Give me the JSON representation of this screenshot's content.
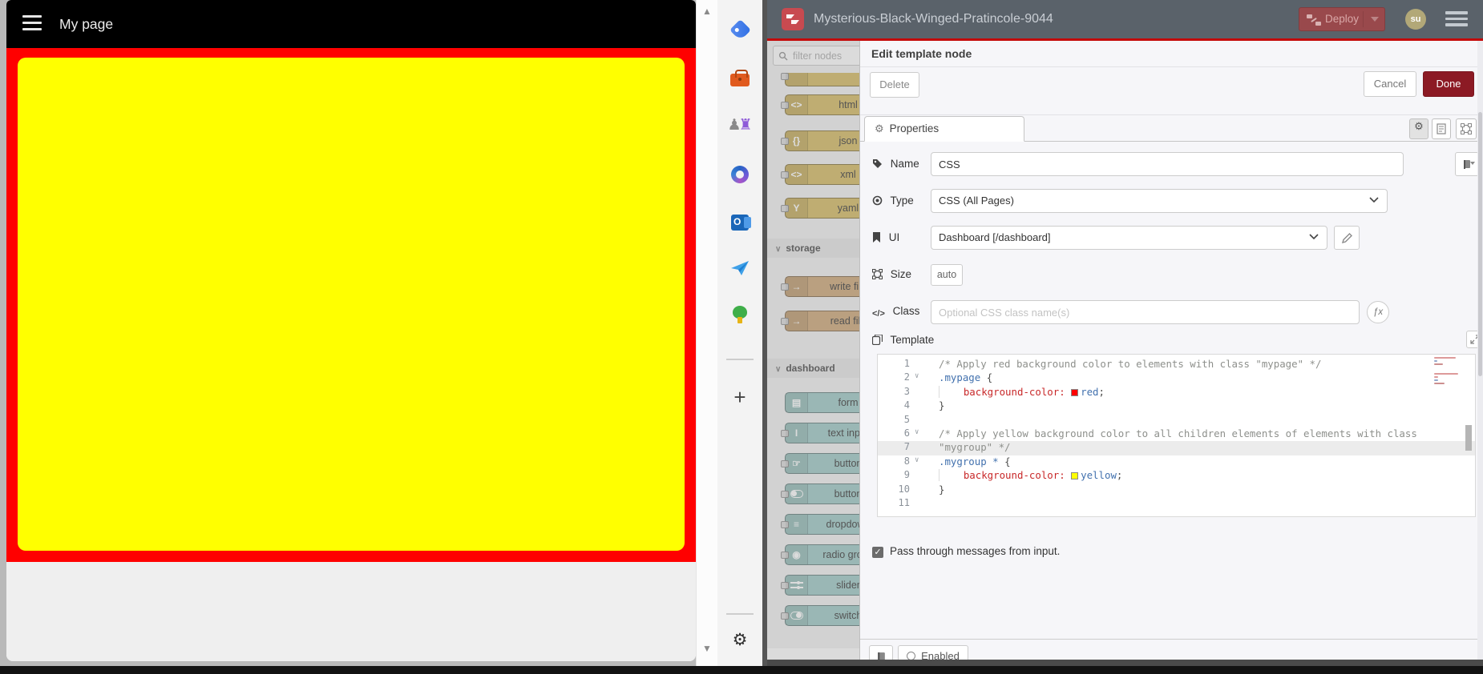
{
  "colors": {
    "page_red": "#ff0000",
    "group_yellow": "#ffff00",
    "done_red": "#8c1a24",
    "deploy_red": "#99494c",
    "header_grey": "#5a626a",
    "node_parser": "#d8bf6e",
    "node_storage": "#d2ae82",
    "node_dashboard": "#a6cecb"
  },
  "dashboard_page": {
    "title": "My page"
  },
  "edge_sidebar": {
    "icons": [
      "shopping-tag-icon",
      "toolbox-icon",
      "games-icon",
      "microsoft-365-icon",
      "outlook-icon",
      "drop-plane-icon",
      "tree-icon"
    ],
    "add_label": "+",
    "settings_icon": "gear-icon"
  },
  "nodered": {
    "header": {
      "title": "Mysterious-Black-Winged-Pratincole-9044",
      "deploy_label": "Deploy",
      "avatar_initials": "su"
    },
    "palette": {
      "filter_placeholder": "filter nodes",
      "groups": [
        {
          "header": "",
          "color": "#d8bf6e",
          "nodes": [
            {
              "label": "",
              "icon": ""
            },
            {
              "label": "html",
              "icon": "<>"
            },
            {
              "label": "json",
              "icon": "{}"
            },
            {
              "label": "xml",
              "icon": "<>"
            },
            {
              "label": "yaml",
              "icon": "Y"
            }
          ]
        },
        {
          "header": "storage",
          "color": "#d2ae82",
          "nodes": [
            {
              "label": "write file",
              "icon": "→"
            },
            {
              "label": "read file",
              "icon": "→"
            }
          ]
        },
        {
          "header": "dashboard",
          "color": "#a6cecb",
          "nodes": [
            {
              "label": "form",
              "icon": "▤",
              "noport": true
            },
            {
              "label": "text input",
              "icon": "I"
            },
            {
              "label": "button",
              "icon": "☞"
            },
            {
              "label": "button",
              "icon": "__toggle"
            },
            {
              "label": "dropdown",
              "icon": "≡"
            },
            {
              "label": "radio group",
              "icon": "◉"
            },
            {
              "label": "slider",
              "icon": "__slider"
            },
            {
              "label": "switch",
              "icon": "__switch"
            }
          ]
        }
      ]
    },
    "tray": {
      "title": "Edit template node",
      "delete_label": "Delete",
      "cancel_label": "Cancel",
      "done_label": "Done",
      "tab_label": "Properties",
      "fields": {
        "name_label": "Name",
        "name_value": "CSS",
        "type_label": "Type",
        "type_value": "CSS (All Pages)",
        "ui_label": "UI",
        "ui_value": "Dashboard [/dashboard]",
        "size_label": "Size",
        "size_value": "auto",
        "class_label": "Class",
        "class_placeholder": "Optional CSS class name(s)",
        "template_label": "Template"
      },
      "code": {
        "lines": [
          {
            "num": 1,
            "tokens": [
              {
                "t": "c",
                "s": "/* Apply red background color to elements with class \"mypage\" */"
              }
            ]
          },
          {
            "num": 2,
            "fold": true,
            "tokens": [
              {
                "t": "sel",
                "s": ".mypage "
              },
              {
                "t": "p",
                "s": "{"
              }
            ]
          },
          {
            "num": 3,
            "tokens": [
              {
                "t": "g",
                "s": "    "
              },
              {
                "t": "prop",
                "s": "background-color:"
              },
              {
                "t": "p",
                "s": " "
              },
              {
                "t": "swatch",
                "c": "#ff0000"
              },
              {
                "t": "val",
                "s": "red"
              },
              {
                "t": "p",
                "s": ";"
              }
            ]
          },
          {
            "num": 4,
            "tokens": [
              {
                "t": "p",
                "s": "}"
              }
            ]
          },
          {
            "num": 5,
            "tokens": []
          },
          {
            "num": 6,
            "fold": true,
            "tokens": [
              {
                "t": "c",
                "s": "/* Apply yellow background color to all children elements of elements with class"
              }
            ]
          },
          {
            "num": 7,
            "active": true,
            "tokens": [
              {
                "t": "c",
                "s": "\"mygroup\" */"
              }
            ]
          },
          {
            "num": 8,
            "fold": true,
            "tokens": [
              {
                "t": "sel",
                "s": ".mygroup * "
              },
              {
                "t": "p",
                "s": "{"
              }
            ]
          },
          {
            "num": 9,
            "tokens": [
              {
                "t": "g",
                "s": "    "
              },
              {
                "t": "prop",
                "s": "background-color:"
              },
              {
                "t": "p",
                "s": " "
              },
              {
                "t": "swatch",
                "c": "#ffff00"
              },
              {
                "t": "val",
                "s": "yellow"
              },
              {
                "t": "p",
                "s": ";"
              }
            ]
          },
          {
            "num": 10,
            "tokens": [
              {
                "t": "p",
                "s": "}"
              }
            ]
          },
          {
            "num": 11,
            "tokens": []
          }
        ]
      },
      "passthrough_label": "Pass through messages from input.",
      "passthrough_checked": true,
      "enabled_label": "Enabled"
    }
  }
}
